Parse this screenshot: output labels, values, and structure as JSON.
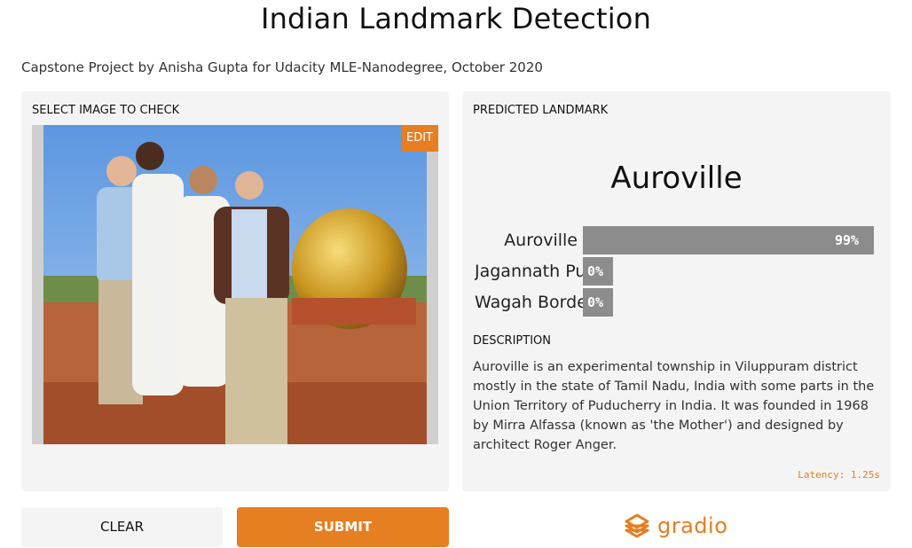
{
  "header": {
    "title": "Indian Landmark Detection",
    "subtitle": "Capstone Project by Anisha Gupta for Udacity MLE-Nanodegree, October 2020"
  },
  "input_panel": {
    "label": "SELECT IMAGE TO CHECK",
    "edit_label": "EDIT"
  },
  "output_panel": {
    "label": "PREDICTED LANDMARK",
    "predicted": "Auroville",
    "confidences": [
      {
        "name": "Auroville",
        "value_label": "99%",
        "value": 0.99
      },
      {
        "name": "Jagannath Pu",
        "value_label": "0%",
        "value": 0.0
      },
      {
        "name": "Wagah Borde",
        "value_label": "0%",
        "value": 0.0
      }
    ],
    "description_label": "DESCRIPTION",
    "description": "Auroville is an experimental township in Viluppuram district mostly in the state of Tamil Nadu, India with some parts in the Union Territory of Puducherry in India. It was founded in 1968 by Mirra Alfassa (known as 'the Mother') and designed by architect Roger Anger.",
    "latency": "Latency: 1.25s"
  },
  "actions": {
    "clear_label": "CLEAR",
    "submit_label": "SUBMIT"
  },
  "brand": {
    "name": "gradio",
    "icon": "gradio-logo-icon",
    "accent_color": "#e67e22",
    "bar_color": "#8c8c8c"
  }
}
